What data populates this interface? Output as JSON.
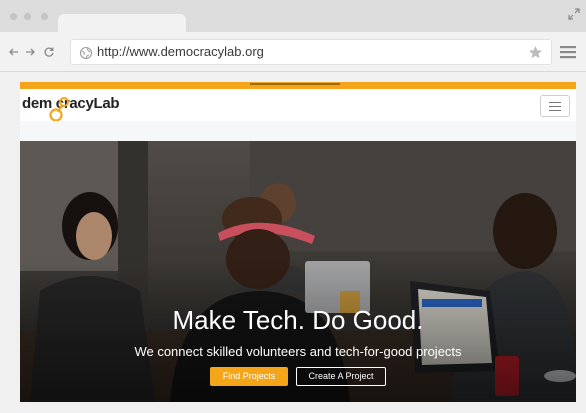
{
  "browser": {
    "url": "http://www.democracylab.org",
    "icons": {
      "back": "arrow-left-icon",
      "forward": "arrow-right-icon",
      "reload": "reload-icon",
      "site": "globe-icon",
      "bookmark": "star-icon",
      "menu": "hamburger-menu-icon",
      "expand": "expand-icon"
    }
  },
  "site": {
    "logo_text": "dem  cracyLab",
    "colors": {
      "accent": "#f4a519",
      "hero_text": "#ffffff"
    },
    "hero": {
      "title": "Make Tech. Do Good.",
      "subtitle": "We connect skilled volunteers and tech-for-good projects",
      "primary_button": "Find Projects",
      "secondary_button": "Create A Project"
    }
  }
}
